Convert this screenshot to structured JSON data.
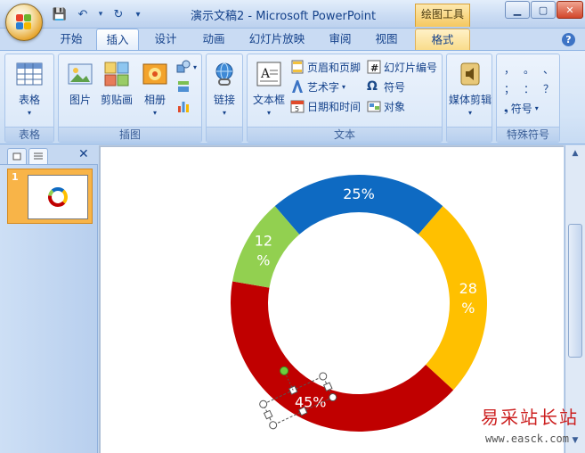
{
  "window": {
    "title": "演示文稿2 - Microsoft PowerPoint",
    "context_tab": "绘图工具",
    "controls": {
      "minimize": "▁",
      "maximize": "▢",
      "close": "✕"
    }
  },
  "quick_access": {
    "save": "💾",
    "undo": "↶",
    "undo_drop": "▾",
    "redo": "↻",
    "customize": "▾"
  },
  "tabs": [
    {
      "label": "开始",
      "active": false
    },
    {
      "label": "插入",
      "active": true
    },
    {
      "label": "设计",
      "active": false
    },
    {
      "label": "动画",
      "active": false
    },
    {
      "label": "幻灯片放映",
      "active": false
    },
    {
      "label": "审阅",
      "active": false
    },
    {
      "label": "视图",
      "active": false
    },
    {
      "label": "格式",
      "active": false
    }
  ],
  "help": "?",
  "ribbon": {
    "groups": {
      "table": {
        "label": "表格",
        "button": "表格"
      },
      "illustrations": {
        "label": "插图",
        "picture": "图片",
        "clipart": "剪贴画",
        "album": "相册"
      },
      "links": {
        "label": "",
        "link": "链接"
      },
      "text": {
        "label": "文本",
        "textbox": "文本框",
        "header_footer": "页眉和页脚",
        "wordart": "艺术字",
        "datetime": "日期和时间",
        "slide_number": "幻灯片编号",
        "symbol": "符号",
        "object": "对象"
      },
      "media": {
        "label": "",
        "clips": "媒体剪辑"
      },
      "special_symbols": {
        "label": "特殊符号",
        "symbols": [
          "，",
          "。",
          "、",
          "；",
          "：",
          "？"
        ],
        "more": "符号",
        "more_prefix": "❟"
      }
    },
    "dropdown_arrow": "▾"
  },
  "left_pane": {
    "close": "✕",
    "slide_number": "1"
  },
  "chart_data": {
    "type": "pie",
    "variant": "doughnut",
    "segments": [
      {
        "label": "25%",
        "value": 25,
        "color": "#0E6AC2"
      },
      {
        "label": "28\n%",
        "value": 28,
        "color": "#FFC000"
      },
      {
        "label": "45%",
        "value": 45,
        "color": "#C00000"
      },
      {
        "label": "12\n%",
        "value": 12,
        "color": "#92D050"
      }
    ]
  },
  "watermark": {
    "text": "易采站长站",
    "url": "www.easck.com"
  }
}
